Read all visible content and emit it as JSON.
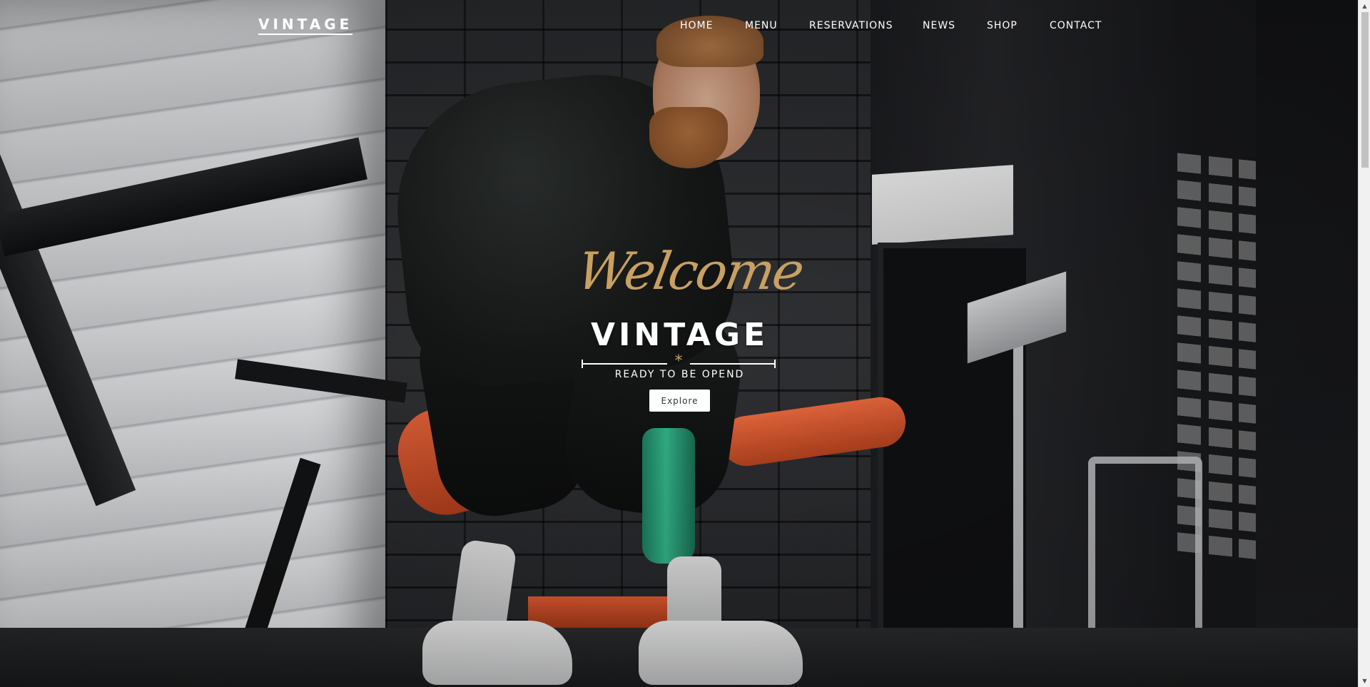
{
  "brand": {
    "logo": "VINTAGE"
  },
  "nav": {
    "items": [
      {
        "label": "HOME"
      },
      {
        "label": "MENU"
      },
      {
        "label": "RESERVATIONS"
      },
      {
        "label": "NEWS"
      },
      {
        "label": "SHOP"
      },
      {
        "label": "CONTACT"
      }
    ]
  },
  "hero": {
    "script_heading": "Welcome",
    "title": "VINTAGE",
    "divider_glyph": "*",
    "tagline": "READY TO BE OPEND",
    "button_label": "Explore",
    "background_description_icon": "gym-photo"
  },
  "colors": {
    "accent_gold": "#c9a063",
    "text_white": "#ffffff",
    "button_bg": "#ffffff"
  },
  "scrollbar": {
    "up_icon": "▲",
    "down_icon": "▼"
  }
}
